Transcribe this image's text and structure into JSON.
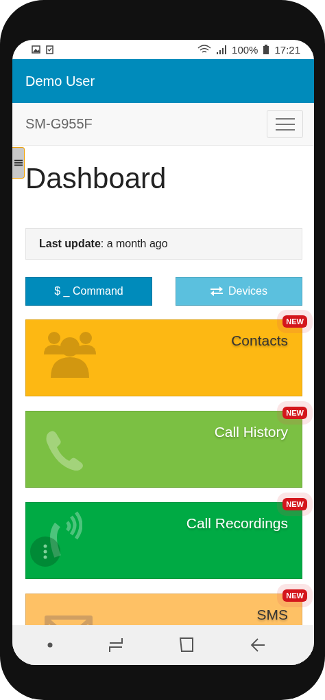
{
  "status_bar": {
    "battery": "100%",
    "time": "17:21"
  },
  "app_bar": {
    "title": "Demo User"
  },
  "navbar": {
    "brand": "SM-G955F"
  },
  "page": {
    "title": "Dashboard"
  },
  "last_update": "**Last update**: a month ago",
  "buttons": [
    {
      "kind": "command",
      "label": "$ _ Command",
      "color": "#008bbb"
    },
    {
      "kind": "devices",
      "label": "Devices",
      "color": "#5bc0de"
    }
  ],
  "tiles": [
    {
      "kind": "contacts",
      "label": "Contacts",
      "badge": "NEW",
      "color": "#fdb813"
    },
    {
      "kind": "history",
      "label": "Call History",
      "badge": "NEW",
      "color": "#7bc043"
    },
    {
      "kind": "recordings",
      "label": "Call Recordings",
      "badge": "NEW",
      "color": "#00aa44"
    },
    {
      "kind": "sms",
      "label": "SMS",
      "badge": "NEW",
      "color": "#fec165"
    }
  ]
}
